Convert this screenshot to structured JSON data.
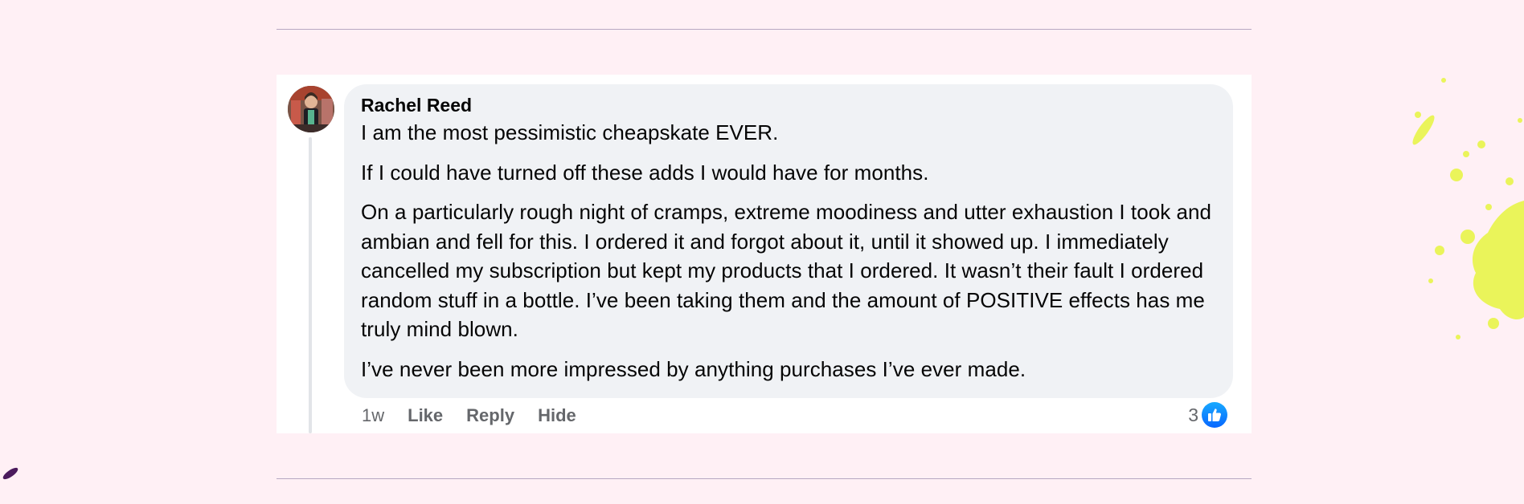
{
  "comment": {
    "author": "Rachel Reed",
    "paragraphs": [
      "I am the most pessimistic cheapskate EVER.",
      "If I could have turned off these adds I would have for months.",
      "On a particularly rough night of cramps, extreme moodiness and utter exhaustion I took and ambian and fell for this. I ordered it and forgot about it, until it showed up. I immediately cancelled my subscription but kept my products that I ordered. It wasn’t their fault I ordered random stuff in a bottle. I’ve been taking them and the amount of POSITIVE effects has me truly mind blown.",
      "I’ve never been more impressed by anything purchases I’ve ever made."
    ],
    "timestamp": "1w",
    "actions": {
      "like": "Like",
      "reply": "Reply",
      "hide": "Hide"
    },
    "reaction_count": "3",
    "reaction_icon": "thumbs-up-icon"
  },
  "colors": {
    "background": "#fff0f5",
    "bubble": "#f0f2f5",
    "reaction_blue": "#0866ff",
    "splatter": "#e6f542",
    "ink": "#4b1a5c"
  }
}
